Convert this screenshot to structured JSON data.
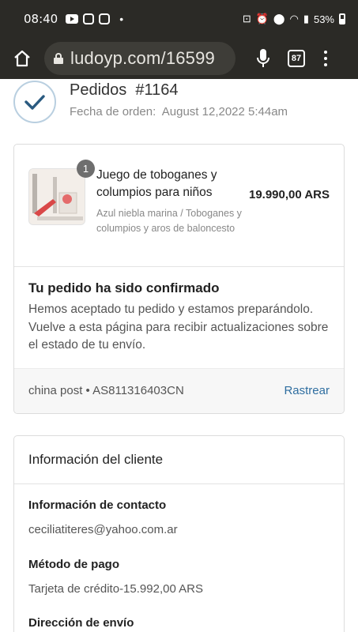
{
  "status_bar": {
    "time": "08:40",
    "battery": "53%"
  },
  "browser": {
    "url": "ludoyp.com/16599",
    "tab_count": "87"
  },
  "order": {
    "title": "Pedidos  #1164",
    "date_label": "Fecha de orden:",
    "date_value": "August 12,2022 5:44am"
  },
  "product": {
    "quantity": "1",
    "name": "Juego de toboganes y columpios para niños",
    "variant": "Azul niebla marina / Toboganes y columpios y aros de baloncesto",
    "price": "19.990,00 ARS"
  },
  "confirmation": {
    "title": "Tu pedido ha sido confirmado",
    "text": "Hemos aceptado tu pedido y estamos preparándolo. Vuelve a esta página para recibir actualizaciones sobre el estado de tu envío."
  },
  "tracking": {
    "info": "china post • AS811316403CN",
    "link": "Rastrear"
  },
  "customer": {
    "title": "Información del cliente",
    "contact_label": "Información de contacto",
    "contact_value": "ceciliatiteres@yahoo.com.ar",
    "payment_label": "Método de pago",
    "payment_value": "Tarjeta de crédito-15.992,00 ARS",
    "shipping_label": "Dirección de envío"
  },
  "colors": {
    "browser_chrome": "#2b2a26",
    "link": "#2f6ea0",
    "check_icon": "#2a5a80"
  }
}
